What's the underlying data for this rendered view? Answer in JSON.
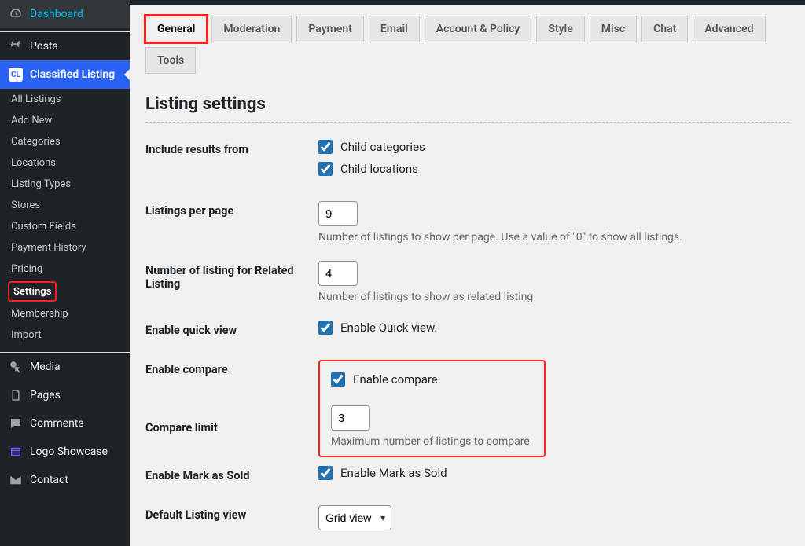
{
  "sidebar": {
    "items": [
      {
        "label": "Dashboard"
      },
      {
        "label": "Posts"
      },
      {
        "label": "Classified Listing"
      }
    ],
    "subitems": [
      {
        "label": "All Listings"
      },
      {
        "label": "Add New"
      },
      {
        "label": "Categories"
      },
      {
        "label": "Locations"
      },
      {
        "label": "Listing Types"
      },
      {
        "label": "Stores"
      },
      {
        "label": "Custom Fields"
      },
      {
        "label": "Payment History"
      },
      {
        "label": "Pricing"
      },
      {
        "label": "Settings"
      },
      {
        "label": "Membership"
      },
      {
        "label": "Import"
      }
    ],
    "items2": [
      {
        "label": "Media"
      },
      {
        "label": "Pages"
      },
      {
        "label": "Comments"
      },
      {
        "label": "Logo Showcase"
      },
      {
        "label": "Contact"
      }
    ]
  },
  "tabs": [
    "General",
    "Moderation",
    "Payment",
    "Email",
    "Account & Policy",
    "Style",
    "Misc",
    "Chat",
    "Advanced",
    "Tools"
  ],
  "title": "Listing settings",
  "fields": {
    "include": {
      "label": "Include results from",
      "childCategories": "Child categories",
      "childLocations": "Child locations"
    },
    "perPage": {
      "label": "Listings per page",
      "value": "9",
      "desc": "Number of listings to show per page. Use a value of \"0\" to show all listings."
    },
    "related": {
      "label": "Number of listing for Related Listing",
      "value": "4",
      "desc": "Number of listings to show as related listing"
    },
    "quickView": {
      "label": "Enable quick view",
      "checkbox": "Enable Quick view."
    },
    "compare": {
      "label": "Enable compare",
      "checkbox": "Enable compare"
    },
    "compareLimit": {
      "label": "Compare limit",
      "value": "3",
      "desc": "Maximum number of listings to compare"
    },
    "markSold": {
      "label": "Enable Mark as Sold",
      "checkbox": "Enable Mark as Sold"
    },
    "defaultView": {
      "label": "Default Listing view",
      "value": "Grid view"
    }
  }
}
